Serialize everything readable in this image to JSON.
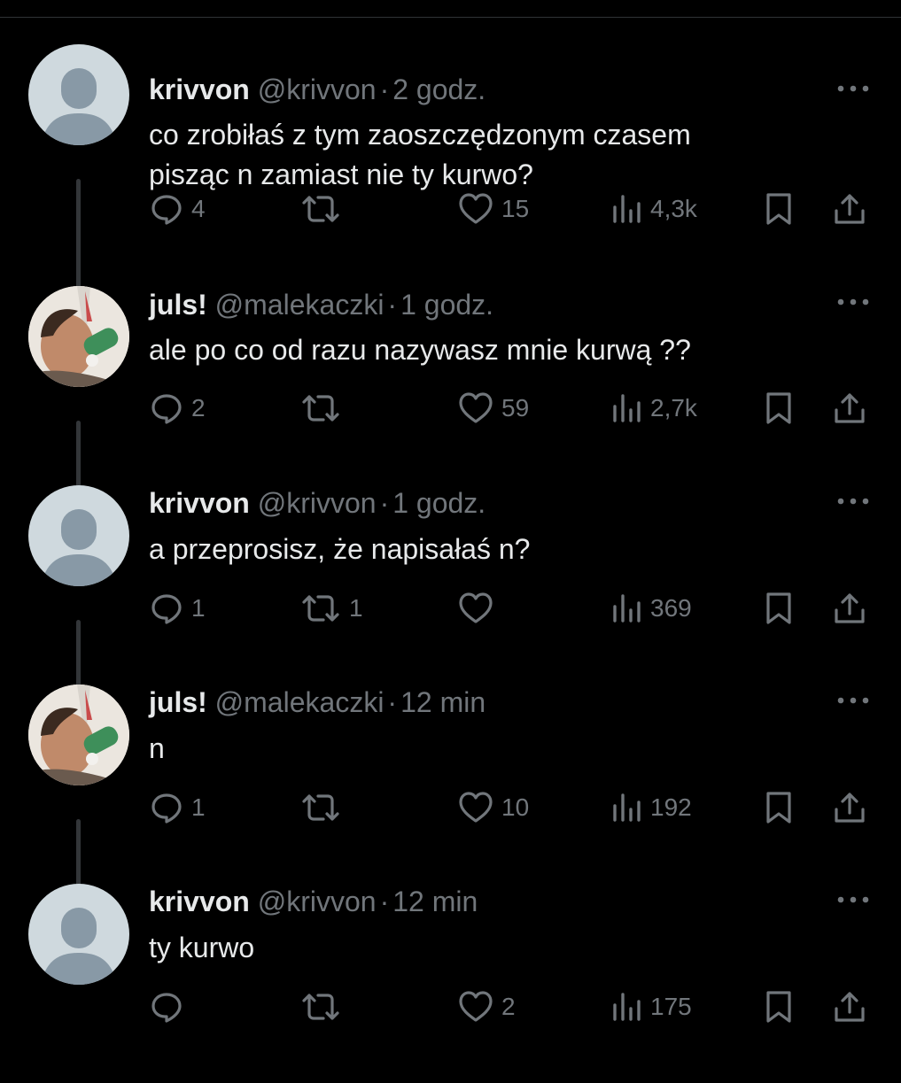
{
  "tweets": [
    {
      "name": "krivvon",
      "handle": "@krivvon",
      "dot": "·",
      "time": "2 godz.",
      "avatar": "default-avatar",
      "text": "co zrobiłaś z tym zaoszczędzonym czasem\npisząc n zamiast nie ty kurwo?",
      "replies": "4",
      "retweets": "",
      "likes": "15",
      "views": "4,3k"
    },
    {
      "name": "juls!",
      "handle": "@malekaczki",
      "dot": "·",
      "time": "1 godz.",
      "avatar": "photo-avatar",
      "text": "ale po co od razu nazywasz mnie kurwą ??",
      "replies": "2",
      "retweets": "",
      "likes": "59",
      "views": "2,7k"
    },
    {
      "name": "krivvon",
      "handle": "@krivvon",
      "dot": "·",
      "time": "1 godz.",
      "avatar": "default-avatar",
      "text": "a przeprosisz, że napisałaś n?",
      "replies": "1",
      "retweets": "1",
      "likes": "",
      "views": "369"
    },
    {
      "name": "juls!",
      "handle": "@malekaczki",
      "dot": "·",
      "time": "12 min",
      "avatar": "photo-avatar",
      "text": "n",
      "replies": "1",
      "retweets": "",
      "likes": "10",
      "views": "192"
    },
    {
      "name": "krivvon",
      "handle": "@krivvon",
      "dot": "·",
      "time": "12 min",
      "avatar": "default-avatar",
      "text": "ty kurwo",
      "replies": "",
      "retweets": "",
      "likes": "2",
      "views": "175"
    }
  ],
  "icons": {
    "more": "more-horizontal-icon",
    "reply": "reply-icon",
    "retweet": "retweet-icon",
    "like": "like-icon",
    "views": "views-icon",
    "bookmark": "bookmark-icon",
    "share": "share-icon"
  },
  "colors": {
    "background": "#000000",
    "text": "#e7e9ea",
    "muted": "#71767b",
    "thread_line": "#333639",
    "default_avatar_bg": "#cfd9de",
    "default_avatar_fg": "#8899a6"
  }
}
